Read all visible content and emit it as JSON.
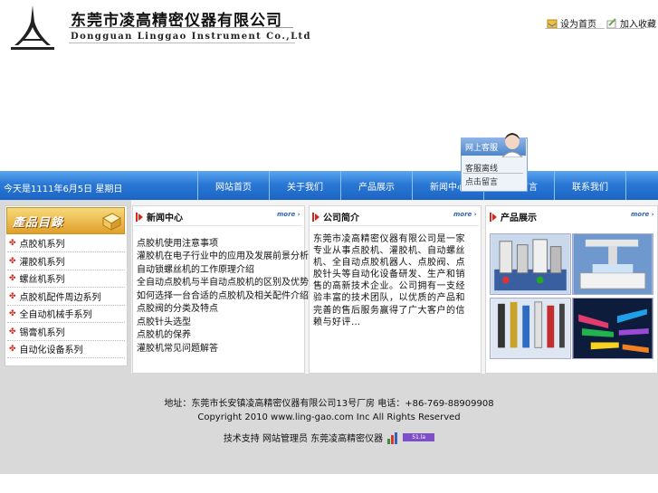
{
  "header": {
    "company_cn": "东莞市凌高精密仪器有限公司",
    "company_en": "Dongguan Linggao Instrument Co.,Ltd",
    "link1": "设为首页",
    "link2": "加入收藏"
  },
  "nav": {
    "date": "今天是1111年6月5日 星期日",
    "items": [
      "网站首页",
      "关于我们",
      "产品展示",
      "新闻中心",
      "在线留言",
      "联系我们"
    ]
  },
  "service": {
    "title": "网上客服",
    "line1": "客服离线",
    "line2": "点击留言"
  },
  "sidebar": {
    "banner": "產品目錄",
    "items": [
      "点胶机系列",
      "灌胶机系列",
      "螺丝机系列",
      "点胶机配件周边系列",
      "全自动机械手系列",
      "锡膏机系列",
      "自动化设备系列"
    ]
  },
  "news": {
    "title": "新闻中心",
    "more": "more",
    "items": [
      "点胶机使用注意事项",
      "灌胶机在电子行业中的应用及发展前景分析...",
      "自动锁螺丝机的工作原理介绍",
      "全自动点胶机与半自动点胶机的区别及优势...",
      "如何选择一台合适的点胶机及相关配件介绍...",
      "点胶阀的分类及特点",
      "点胶针头选型",
      "点胶机的保养",
      "灌胶机常见问题解答"
    ]
  },
  "about": {
    "title": "公司简介",
    "more": "more",
    "text": "东莞市凌高精密仪器有限公司是一家专业从事点胶机、灌胶机、自动螺丝机、全自动点胶机器人、点胶阀、点胶针头等自动化设备研发、生产和销售的高新技术企业。公司拥有一支经验丰富的技术团队，以优质的产品和完善的售后服务赢得了广大客户的信赖与好评…"
  },
  "products": {
    "title": "产品展示",
    "more": "more"
  },
  "footer": {
    "line1": "地址：东莞市长安镇凌高精密仪器有限公司13号厂房  电话：+86-769-88909908",
    "line2": "Copyright 2010 www.ling-gao.com Inc All Rights Reserved",
    "line3": "技术支持 网站管理员 东莞凌高精密仪器",
    "badge": "51.la"
  },
  "colors": {
    "nav_blue": "#2a78d6",
    "accent_red": "#d8281d",
    "banner_gold": "#e0a02b",
    "footer_gray": "#d9d9d9"
  }
}
